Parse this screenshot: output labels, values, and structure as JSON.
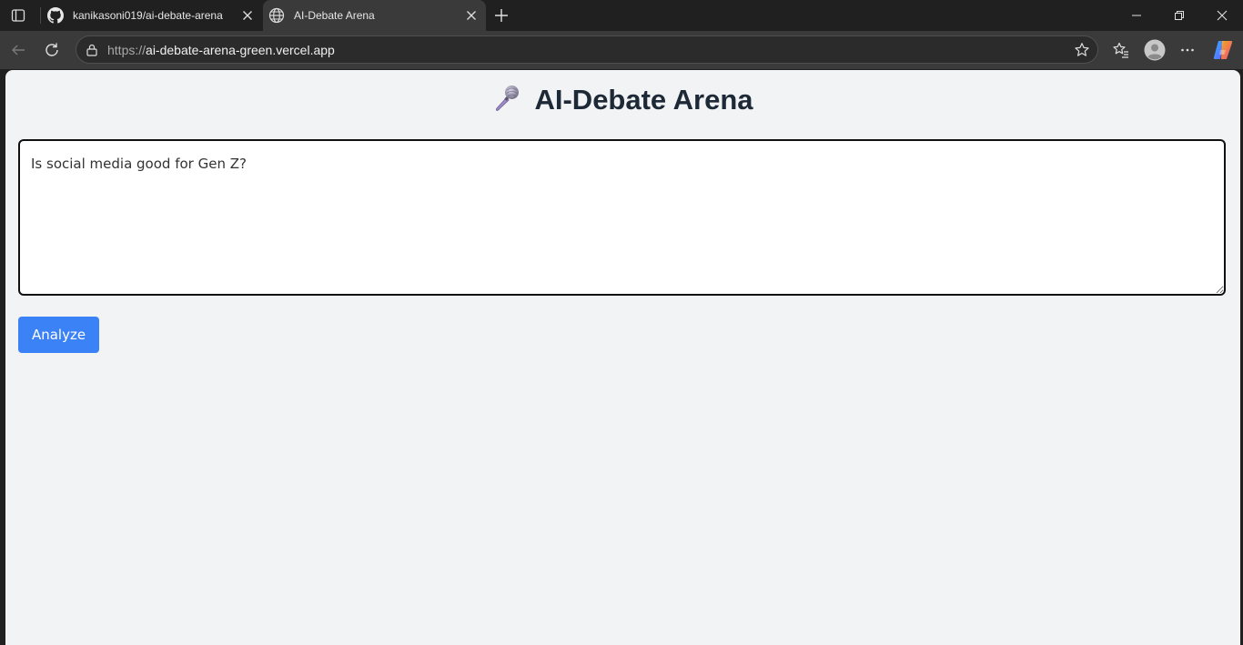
{
  "browser": {
    "tabs": [
      {
        "title": "kanikasoni019/ai-debate-arena",
        "favicon": "github-icon",
        "active": false
      },
      {
        "title": "AI-Debate Arena",
        "favicon": "globe-icon",
        "active": true
      }
    ],
    "address": {
      "scheme": "https://",
      "host": "ai-debate-arena-green.vercel.app"
    }
  },
  "page": {
    "title": "AI-Debate Arena",
    "title_icon": "microphone-icon",
    "input_value": "Is social media good for Gen Z?",
    "analyze_label": "Analyze"
  },
  "colors": {
    "accent": "#3b82f6",
    "page_bg": "#f2f3f5",
    "title_text": "#1e2937"
  }
}
